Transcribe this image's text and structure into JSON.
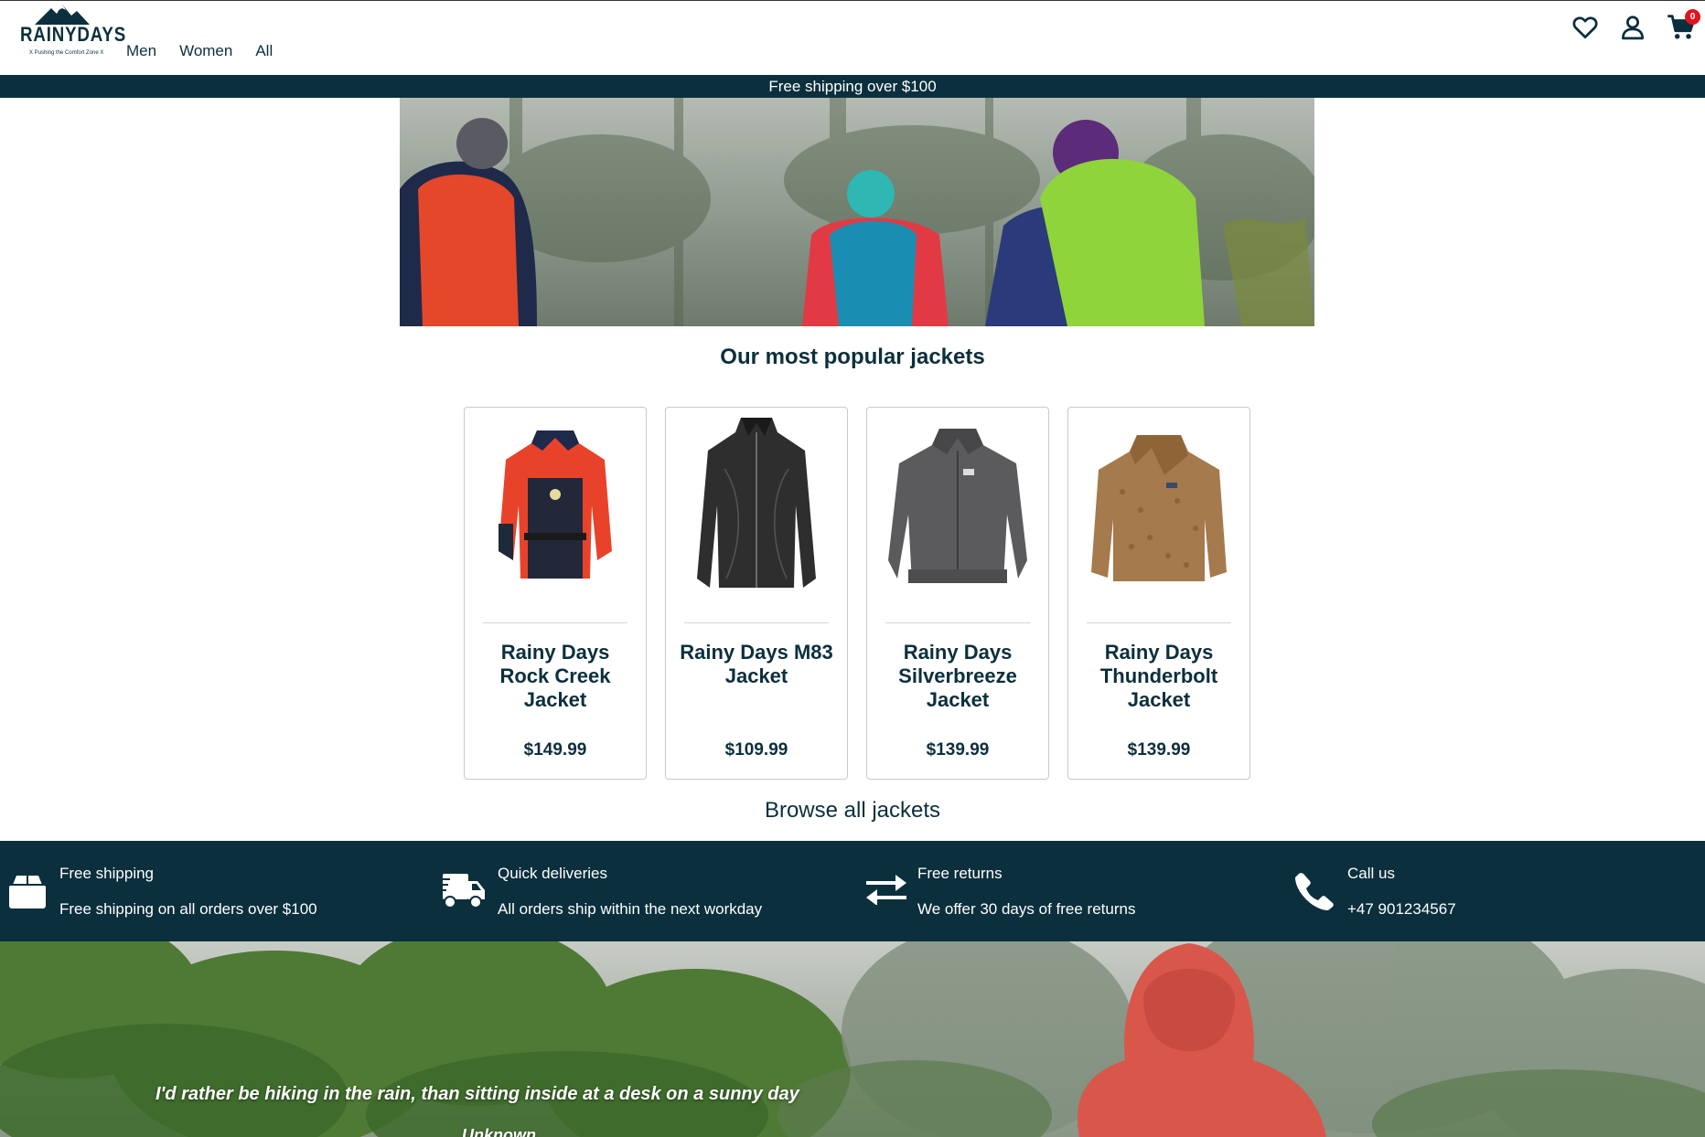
{
  "header": {
    "logo_text": "RAINYDAYS",
    "logo_tagline": "X Pushing the Comfort Zone X",
    "nav": [
      {
        "label": "Men"
      },
      {
        "label": "Women"
      },
      {
        "label": "All"
      }
    ],
    "icons": [
      "heart-icon",
      "user-icon",
      "cart-icon"
    ],
    "cart_count": "0"
  },
  "promo": {
    "text": "Free shipping over $100"
  },
  "main": {
    "section_title": "Our most popular jackets",
    "products": [
      {
        "name": "Rainy Days Rock Creek Jacket",
        "price": "$149.99",
        "color": "#e8432a"
      },
      {
        "name": "Rainy Days M83 Jacket",
        "price": "$109.99",
        "color": "#2e2e2e"
      },
      {
        "name": "Rainy Days Silverbreeze Jacket",
        "price": "$139.99",
        "color": "#5b5b5d"
      },
      {
        "name": "Rainy Days Thunderbolt Jacket",
        "price": "$139.99",
        "color": "#a57a4c"
      }
    ],
    "browse_label": "Browse all jackets"
  },
  "features": [
    {
      "icon": "box-icon",
      "title": "Free shipping",
      "text": "Free shipping on all orders over $100"
    },
    {
      "icon": "truck-icon",
      "title": "Quick deliveries",
      "text": "All orders ship within the next workday"
    },
    {
      "icon": "exchange-icon",
      "title": "Free returns",
      "text": "We offer 30 days of free returns"
    },
    {
      "icon": "phone-icon",
      "title": "Call us",
      "text": "+47 901234567"
    }
  ],
  "banner": {
    "quote": "I'd rather be hiking in the rain, than sitting inside at a desk on a sunny day",
    "author": "Unknown"
  },
  "colors": {
    "brand_dark": "#0b2f3d",
    "badge": "#e0141e"
  }
}
